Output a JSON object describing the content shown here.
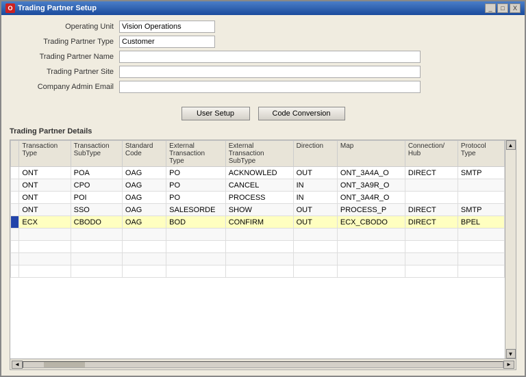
{
  "window": {
    "title": "Trading Partner Setup",
    "title_icon": "O",
    "btn_minimize": "_",
    "btn_maximize": "□",
    "btn_close": "X"
  },
  "form": {
    "operating_unit_label": "Operating Unit",
    "operating_unit_value": "Vision Operations",
    "trading_partner_type_label": "Trading Partner Type",
    "trading_partner_type_value": "Customer",
    "trading_partner_name_label": "Trading Partner Name",
    "trading_partner_name_value": "",
    "trading_partner_site_label": "Trading Partner Site",
    "trading_partner_site_value": "",
    "company_admin_email_label": "Company Admin Email",
    "company_admin_email_value": ""
  },
  "buttons": {
    "user_setup": "User Setup",
    "code_conversion": "Code Conversion"
  },
  "details_title": "Trading Partner Details",
  "table": {
    "columns": [
      {
        "key": "txtype",
        "label": "Transaction\nType"
      },
      {
        "key": "txsubtype",
        "label": "Transaction\nSubType"
      },
      {
        "key": "stdcode",
        "label": "Standard\nCode"
      },
      {
        "key": "exttxtype",
        "label": "External\nTransaction\nType"
      },
      {
        "key": "exttxsubtype",
        "label": "External\nTransaction\nSubType"
      },
      {
        "key": "direction",
        "label": "Direction"
      },
      {
        "key": "map",
        "label": "Map"
      },
      {
        "key": "connhub",
        "label": "Connection/\nHub"
      },
      {
        "key": "protocol",
        "label": "Protocol\nType"
      }
    ],
    "rows": [
      {
        "txtype": "ONT",
        "txsubtype": "POA",
        "stdcode": "OAG",
        "exttxtype": "PO",
        "exttxsubtype": "ACKNOWLED",
        "direction": "OUT",
        "map": "ONT_3A4A_O",
        "connhub": "DIRECT",
        "protocol": "SMTP",
        "selected": false
      },
      {
        "txtype": "ONT",
        "txsubtype": "CPO",
        "stdcode": "OAG",
        "exttxtype": "PO",
        "exttxsubtype": "CANCEL",
        "direction": "IN",
        "map": "ONT_3A9R_O",
        "connhub": "",
        "protocol": "",
        "selected": false
      },
      {
        "txtype": "ONT",
        "txsubtype": "POI",
        "stdcode": "OAG",
        "exttxtype": "PO",
        "exttxsubtype": "PROCESS",
        "direction": "IN",
        "map": "ONT_3A4R_O",
        "connhub": "",
        "protocol": "",
        "selected": false
      },
      {
        "txtype": "ONT",
        "txsubtype": "SSO",
        "stdcode": "OAG",
        "exttxtype": "SALESORDE",
        "exttxsubtype": "SHOW",
        "direction": "OUT",
        "map": "PROCESS_P",
        "connhub": "DIRECT",
        "protocol": "SMTP",
        "selected": false
      },
      {
        "txtype": "ECX",
        "txsubtype": "CBODO",
        "stdcode": "OAG",
        "exttxtype": "BOD",
        "exttxsubtype": "CONFIRM",
        "direction": "OUT",
        "map": "ECX_CBODO",
        "connhub": "DIRECT",
        "protocol": "BPEL",
        "selected": true
      },
      {
        "txtype": "",
        "txsubtype": "",
        "stdcode": "",
        "exttxtype": "",
        "exttxsubtype": "",
        "direction": "",
        "map": "",
        "connhub": "",
        "protocol": "",
        "selected": false
      },
      {
        "txtype": "",
        "txsubtype": "",
        "stdcode": "",
        "exttxtype": "",
        "exttxsubtype": "",
        "direction": "",
        "map": "",
        "connhub": "",
        "protocol": "",
        "selected": false
      },
      {
        "txtype": "",
        "txsubtype": "",
        "stdcode": "",
        "exttxtype": "",
        "exttxsubtype": "",
        "direction": "",
        "map": "",
        "connhub": "",
        "protocol": "",
        "selected": false
      },
      {
        "txtype": "",
        "txsubtype": "",
        "stdcode": "",
        "exttxtype": "",
        "exttxsubtype": "",
        "direction": "",
        "map": "",
        "connhub": "",
        "protocol": "",
        "selected": false
      }
    ]
  }
}
